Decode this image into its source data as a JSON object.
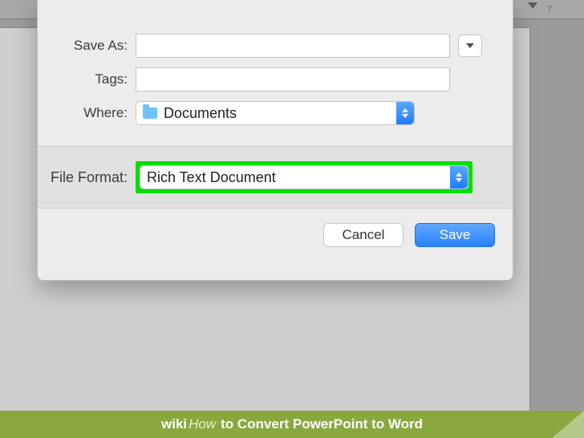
{
  "ruler": {
    "label_7": "7"
  },
  "dialog": {
    "save_as_label": "Save As:",
    "save_as_value": "",
    "tags_label": "Tags:",
    "tags_value": "",
    "where_label": "Where:",
    "where_value": "Documents",
    "format_label": "File Format:",
    "format_value": "Rich Text Document",
    "cancel": "Cancel",
    "save": "Save"
  },
  "caption": {
    "wiki": "wiki",
    "how": "How",
    "title": "to Convert PowerPoint to Word"
  }
}
